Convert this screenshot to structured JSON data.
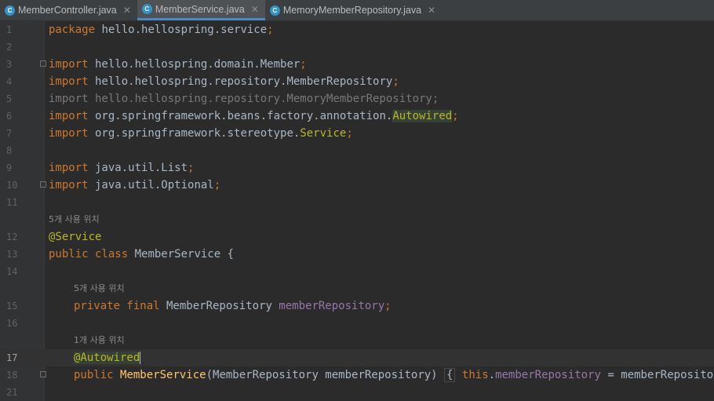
{
  "tabs": [
    {
      "label": "MemberController.java",
      "icon": "C",
      "active": false
    },
    {
      "label": "MemberService.java",
      "icon": "C",
      "active": true
    },
    {
      "label": "MemoryMemberRepository.java",
      "icon": "C",
      "active": false
    }
  ],
  "close_glyph": "✕",
  "line_numbers": [
    "1",
    "2",
    "3",
    "4",
    "5",
    "6",
    "7",
    "8",
    "9",
    "10",
    "11",
    "12",
    "13",
    "14",
    "15",
    "16",
    "17",
    "18",
    "21"
  ],
  "hints": {
    "class_usages": "5개 사용 위치",
    "field_usages": "5개 사용 위치",
    "ctor_usages": "1개 사용 위치"
  },
  "code": {
    "l1_kw": "package",
    "l1_rest": " hello.hellospring.service",
    "l1_semi": ";",
    "import_kw": "import",
    "l3_path": " hello.hellospring.domain.Member",
    "l4_path": " hello.hellospring.repository.MemberRepository",
    "l5_text": "import hello.hellospring.repository.MemoryMemberRepository;",
    "l6_path": " org.springframework.beans.factory.annotation.",
    "l6_name": "Autowired",
    "l7_path": " org.springframework.stereotype.",
    "l7_name": "Service",
    "l9_path": " java.util.List",
    "l10_path": " java.util.Optional",
    "semi": ";",
    "l12_ann": "@Service",
    "l13_kw": "public class",
    "l13_rest": " MemberService {",
    "l15_kw": "private final",
    "l15_type": " MemberRepository ",
    "l15_field": "memberRepository",
    "l17_ann": "@Autowired",
    "l18_kw": "public",
    "l18_fn": "MemberService",
    "l18_params": "(MemberRepository memberRepository) ",
    "l18_open": "{",
    "l18_this": "this",
    "l18_dot": ".",
    "l18_field": "memberRepository",
    "l18_assign": " = memberRepository",
    "l18_close": "}"
  }
}
